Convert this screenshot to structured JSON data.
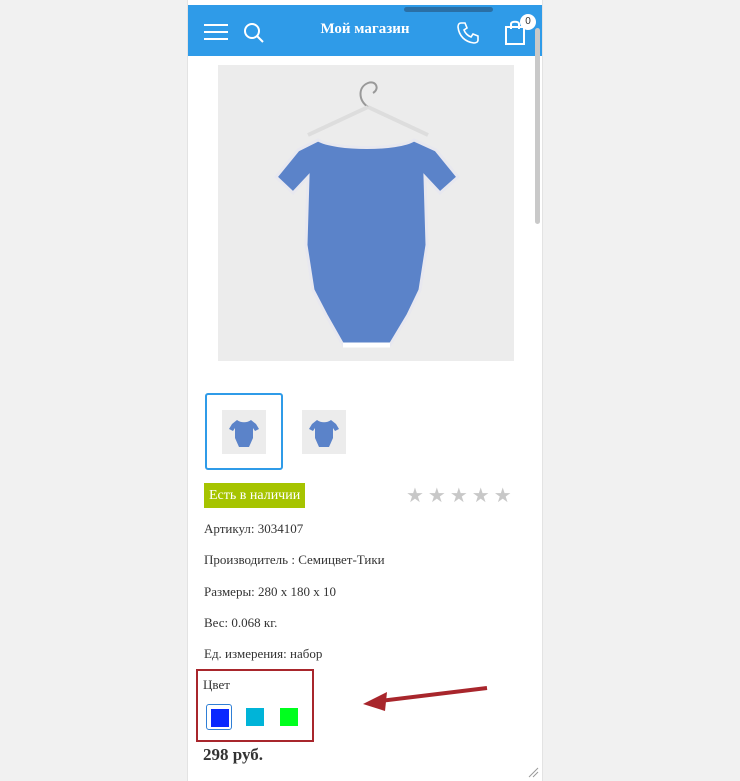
{
  "header": {
    "title": "Мой магазин",
    "cart_count": "0"
  },
  "icons": [
    "menu-icon",
    "search-icon",
    "phone-icon",
    "cart-icon",
    "star-icon"
  ],
  "product": {
    "stock_label": "Есть в наличии",
    "rating_stars": "★★★★★",
    "rating_value": 0,
    "specs": [
      "Артикул: 3034107",
      "Производитель : Семицвет-Тики",
      "Размеры: 280 x 180 x 10",
      "Вес: 0.068 кг.",
      "Ед. измерения: набор"
    ],
    "color_label": "Цвет",
    "colors": [
      "#0a28ff",
      "#00b4d8",
      "#00ff1e"
    ],
    "price": "298 руб."
  },
  "colors": {
    "accent": "#2f9be8",
    "stock": "#a6c400",
    "annotation": "#a8262c"
  }
}
